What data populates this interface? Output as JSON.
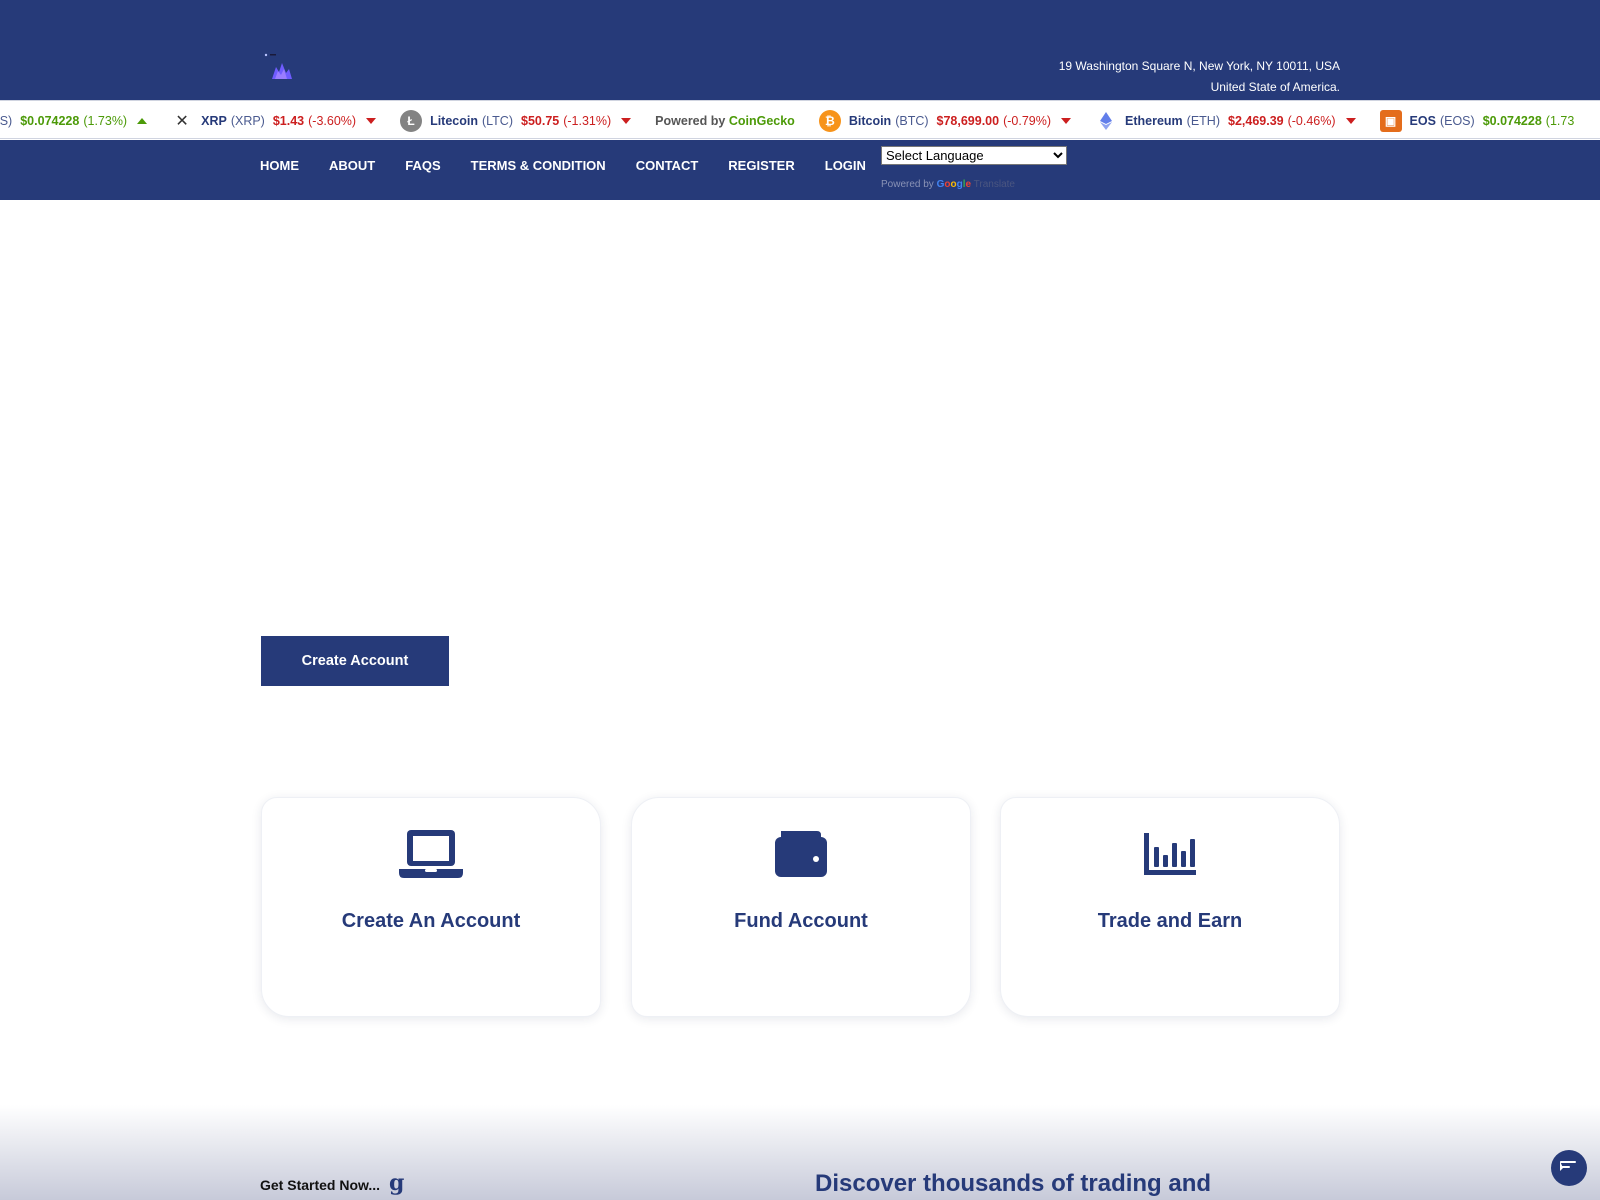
{
  "header": {
    "address_line1": "19 Washington Square N, New York, NY 10011, USA",
    "address_line2": "United State of America."
  },
  "ticker": {
    "items": [
      {
        "name": "",
        "symbol": "OS)",
        "price": "$0.074228",
        "change": "(1.73%)",
        "direction": "up",
        "icon": "none"
      },
      {
        "name": "XRP",
        "symbol": "(XRP)",
        "price": "$1.43",
        "change": "(-3.60%)",
        "direction": "down",
        "icon": "xrp-icon"
      },
      {
        "name": "Litecoin",
        "symbol": "(LTC)",
        "price": "$50.75",
        "change": "(-1.31%)",
        "direction": "down",
        "icon": "litecoin-icon"
      },
      {
        "name": "Bitcoin",
        "symbol": "(BTC)",
        "price": "$78,699.00",
        "change": "(-0.79%)",
        "direction": "down",
        "icon": "bitcoin-icon"
      },
      {
        "name": "Ethereum",
        "symbol": "(ETH)",
        "price": "$2,469.39",
        "change": "(-0.46%)",
        "direction": "down",
        "icon": "ethereum-icon"
      },
      {
        "name": "EOS",
        "symbol": "(EOS)",
        "price": "$0.074228",
        "change": "(1.73",
        "direction": "up",
        "icon": "eos-icon"
      }
    ],
    "powered_by_prefix": "Powered by",
    "powered_by_brand": "CoinGecko"
  },
  "nav": {
    "items": [
      "HOME",
      "ABOUT",
      "FAQS",
      "TERMS & CONDITION",
      "CONTACT",
      "REGISTER",
      "LOGIN"
    ],
    "language_select": "Select Language",
    "google_powered_prefix": "Powered by",
    "google_translate": "Translate"
  },
  "hero": {
    "cta_label": "Create Account"
  },
  "steps": [
    {
      "title": "Create An Account",
      "icon": "laptop-icon"
    },
    {
      "title": "Fund Account",
      "icon": "wallet-icon"
    },
    {
      "title": "Trade and Earn",
      "icon": "chart-bar-icon"
    }
  ],
  "bottom": {
    "get_started": "Get Started Now...",
    "get_started_mark": "g",
    "discover": "Discover thousands of trading and"
  },
  "colors": {
    "primary": "#263a79",
    "up": "#4c9a08",
    "down": "#cc1f1f"
  }
}
